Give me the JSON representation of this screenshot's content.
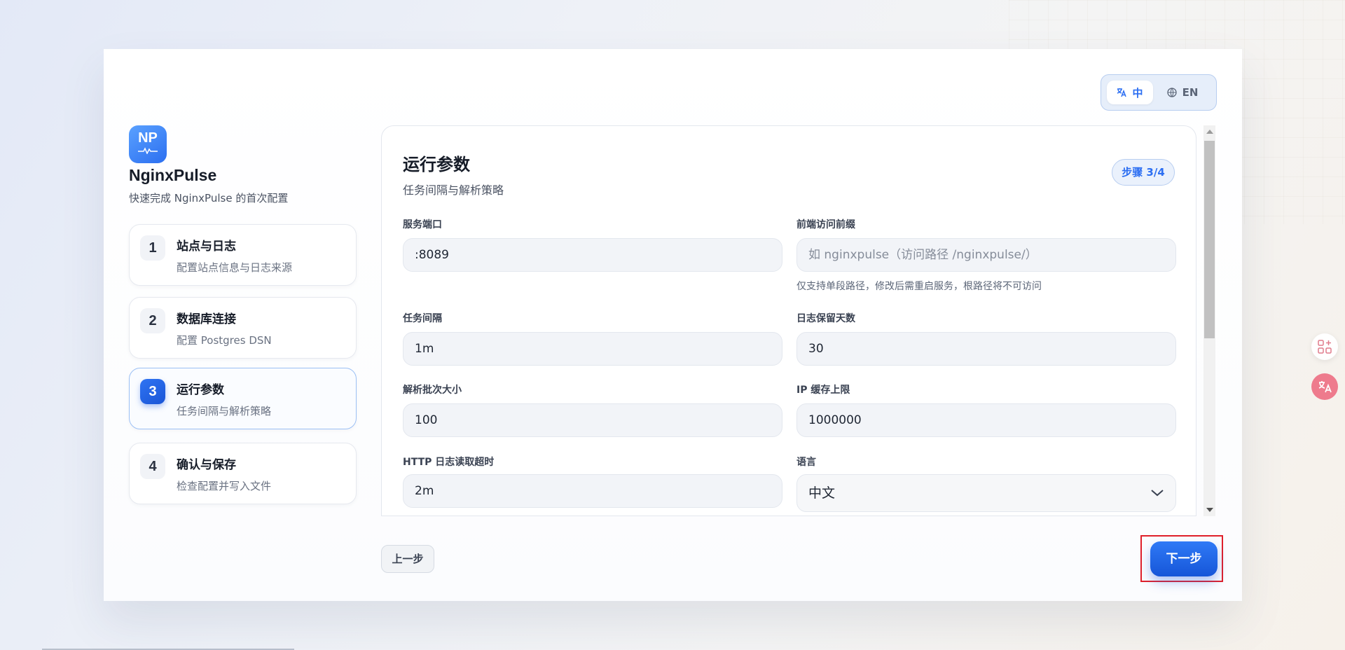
{
  "brand": {
    "logo_text": "NP",
    "name": "NginxPulse",
    "subtitle": "快速完成 NginxPulse 的首次配置"
  },
  "language": {
    "active": "中",
    "inactive": "EN"
  },
  "steps": [
    {
      "num": "1",
      "title": "站点与日志",
      "desc": "配置站点信息与日志来源",
      "active": false
    },
    {
      "num": "2",
      "title": "数据库连接",
      "desc": "配置 Postgres DSN",
      "active": false
    },
    {
      "num": "3",
      "title": "运行参数",
      "desc": "任务间隔与解析策略",
      "active": true
    },
    {
      "num": "4",
      "title": "确认与保存",
      "desc": "检查配置并写入文件",
      "active": false
    }
  ],
  "panel": {
    "title": "运行参数",
    "subtitle": "任务间隔与解析策略",
    "step_badge": "步骤 3/4",
    "fields": {
      "port": {
        "label": "服务端口",
        "value": ":8089"
      },
      "prefix": {
        "label": "前端访问前缀",
        "placeholder": "如 nginxpulse（访问路径 /nginxpulse/）",
        "hint": "仅支持单段路径，修改后需重启服务，根路径将不可访问"
      },
      "interval": {
        "label": "任务间隔",
        "value": "1m"
      },
      "retention": {
        "label": "日志保留天数",
        "value": "30"
      },
      "batch": {
        "label": "解析批次大小",
        "value": "100"
      },
      "ip_cache": {
        "label": "IP 缓存上限",
        "value": "1000000"
      },
      "http_timeout": {
        "label": "HTTP 日志读取超时",
        "value": "2m"
      },
      "language": {
        "label": "语言",
        "value": "中文"
      }
    }
  },
  "footer": {
    "prev": "上一步",
    "next": "下一步"
  },
  "colors": {
    "accent": "#2b6ef2",
    "highlight_border": "#e0202a"
  }
}
